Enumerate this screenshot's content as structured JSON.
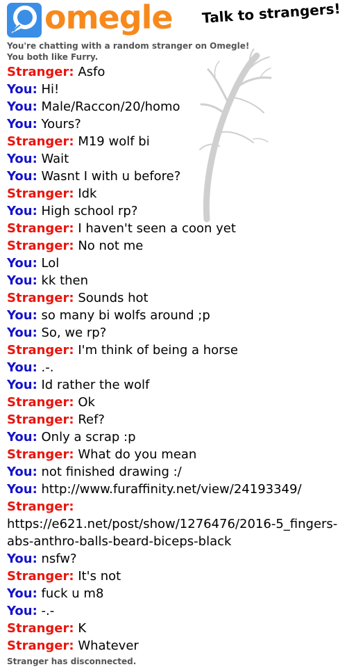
{
  "header": {
    "logo_text": "omegle",
    "tagline": "Talk to strangers!"
  },
  "info": {
    "line1": "You're chatting with a random stranger on Omegle!",
    "line2": "You both like Furry."
  },
  "labels": {
    "stranger": "Stranger:",
    "you": "You:"
  },
  "colors": {
    "brand_orange": "#f7891c",
    "brand_blue": "#3a8ee6",
    "stranger": "#e8150e",
    "you": "#1412cc"
  },
  "messages": [
    {
      "who": "stranger",
      "text": "Asfo"
    },
    {
      "who": "you",
      "text": "Hi!"
    },
    {
      "who": "you",
      "text": "Male/Raccon/20/homo"
    },
    {
      "who": "you",
      "text": "Yours?"
    },
    {
      "who": "stranger",
      "text": "M19 wolf bi"
    },
    {
      "who": "you",
      "text": "Wait"
    },
    {
      "who": "you",
      "text": "Wasnt I with u before?"
    },
    {
      "who": "stranger",
      "text": "Idk"
    },
    {
      "who": "you",
      "text": "High school rp?"
    },
    {
      "who": "stranger",
      "text": "I haven't seen a coon yet"
    },
    {
      "who": "stranger",
      "text": "No not me"
    },
    {
      "who": "you",
      "text": "Lol"
    },
    {
      "who": "you",
      "text": "kk then"
    },
    {
      "who": "stranger",
      "text": "Sounds hot"
    },
    {
      "who": "you",
      "text": "so many bi wolfs around ;p"
    },
    {
      "who": "you",
      "text": "So, we rp?"
    },
    {
      "who": "stranger",
      "text": "I'm think of being a horse"
    },
    {
      "who": "you",
      "text": ".-."
    },
    {
      "who": "you",
      "text": "Id rather the wolf"
    },
    {
      "who": "stranger",
      "text": "Ok"
    },
    {
      "who": "stranger",
      "text": "Ref?"
    },
    {
      "who": "you",
      "text": "Only a scrap :p"
    },
    {
      "who": "stranger",
      "text": "What do you mean"
    },
    {
      "who": "you",
      "text": "not finished drawing :/"
    },
    {
      "who": "you",
      "text": "http://www.furaffinity.net/view/24193349/"
    },
    {
      "who": "stranger",
      "text": "https://e621.net/post/show/1276476/2016-5_fingers-abs-anthro-balls-beard-biceps-black"
    },
    {
      "who": "you",
      "text": "nsfw?"
    },
    {
      "who": "stranger",
      "text": "It's not"
    },
    {
      "who": "you",
      "text": "fuck u m8"
    },
    {
      "who": "you",
      "text": "-.-"
    },
    {
      "who": "stranger",
      "text": "K"
    },
    {
      "who": "stranger",
      "text": "Whatever"
    }
  ],
  "status": "Stranger has disconnected."
}
